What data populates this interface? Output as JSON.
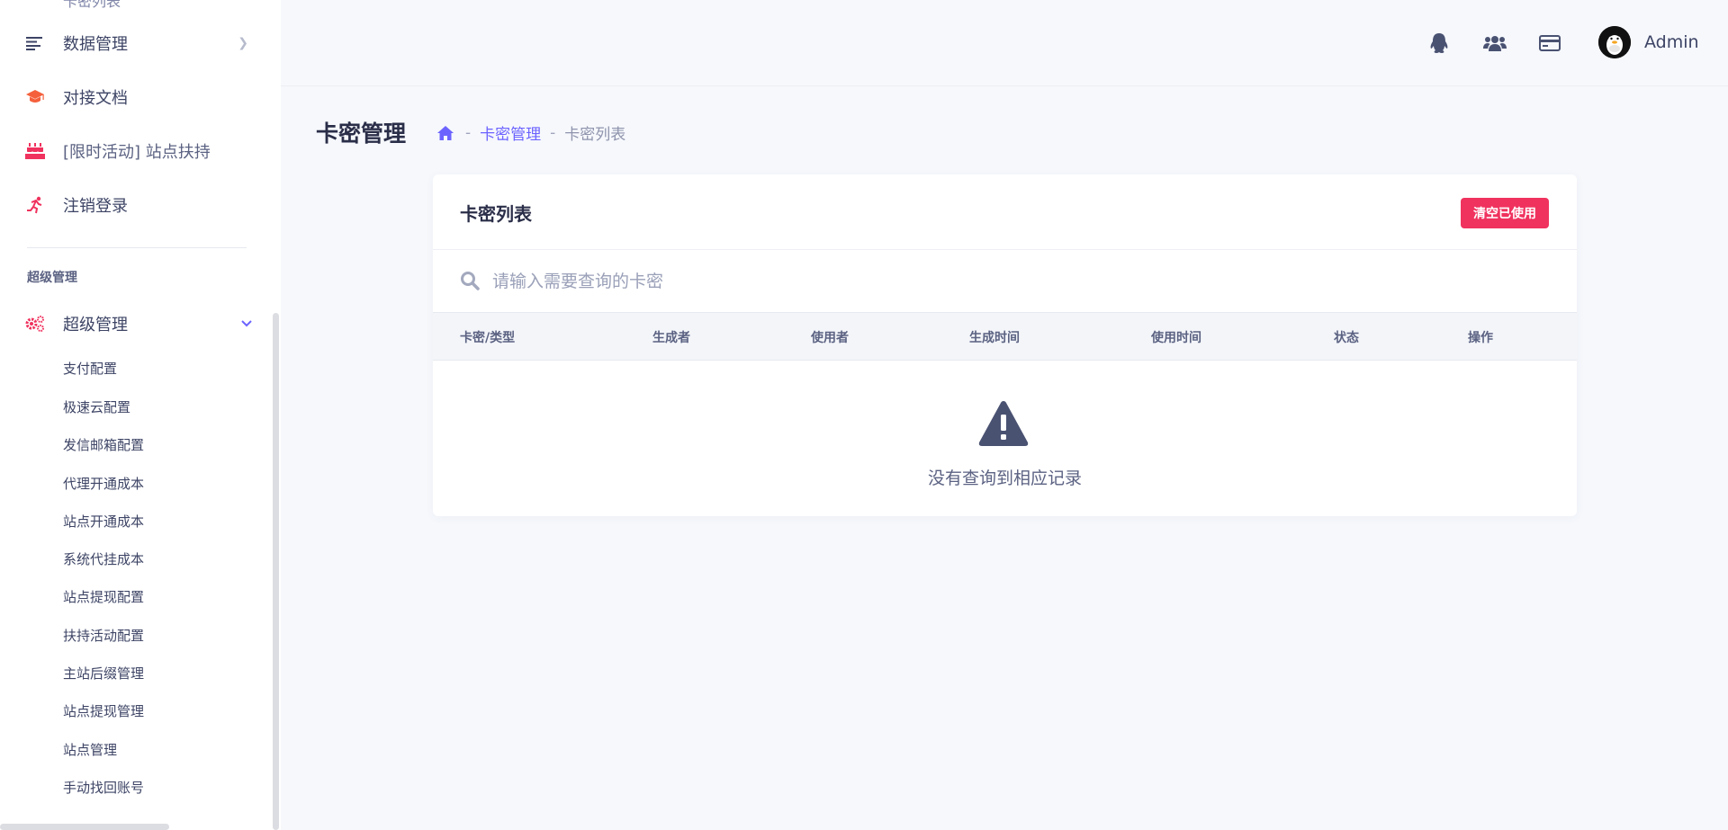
{
  "sidebar": {
    "cut_off_item": "卡密列表",
    "nav": [
      {
        "label": "数据管理",
        "icon": "list-icon"
      },
      {
        "label": "对接文档",
        "icon": "graduation-cap-icon"
      },
      {
        "label": "[限时活动] 站点扶持",
        "icon": "birthday-cake-icon"
      },
      {
        "label": "注销登录",
        "icon": "running-icon"
      }
    ],
    "section_title": "超级管理",
    "super_admin": {
      "label": "超级管理",
      "icon": "gears-icon"
    },
    "sub_items": [
      "支付配置",
      "极速云配置",
      "发信邮箱配置",
      "代理开通成本",
      "站点开通成本",
      "系统代挂成本",
      "站点提现配置",
      "扶持活动配置",
      "主站后缀管理",
      "站点提现管理",
      "站点管理",
      "手动找回账号"
    ]
  },
  "header": {
    "icons": [
      "qq-icon",
      "users-icon",
      "credit-card-icon"
    ],
    "user_name": "Admin"
  },
  "page": {
    "title": "卡密管理",
    "breadcrumb": {
      "link": "卡密管理",
      "current": "卡密列表",
      "separator": "-"
    }
  },
  "card": {
    "title": "卡密列表",
    "clear_button": "清空已使用",
    "search_placeholder": "请输入需要查询的卡密",
    "columns": [
      "卡密/类型",
      "生成者",
      "使用者",
      "生成时间",
      "使用时间",
      "状态",
      "操作"
    ],
    "empty_text": "没有查询到相应记录"
  },
  "colors": {
    "accent": "#6c63ff",
    "danger": "#f0325e",
    "icon_orange": "#f5603c",
    "icon_red": "#f0325e",
    "text_dark": "#2b2e48",
    "empty_icon": "#4a5272"
  }
}
